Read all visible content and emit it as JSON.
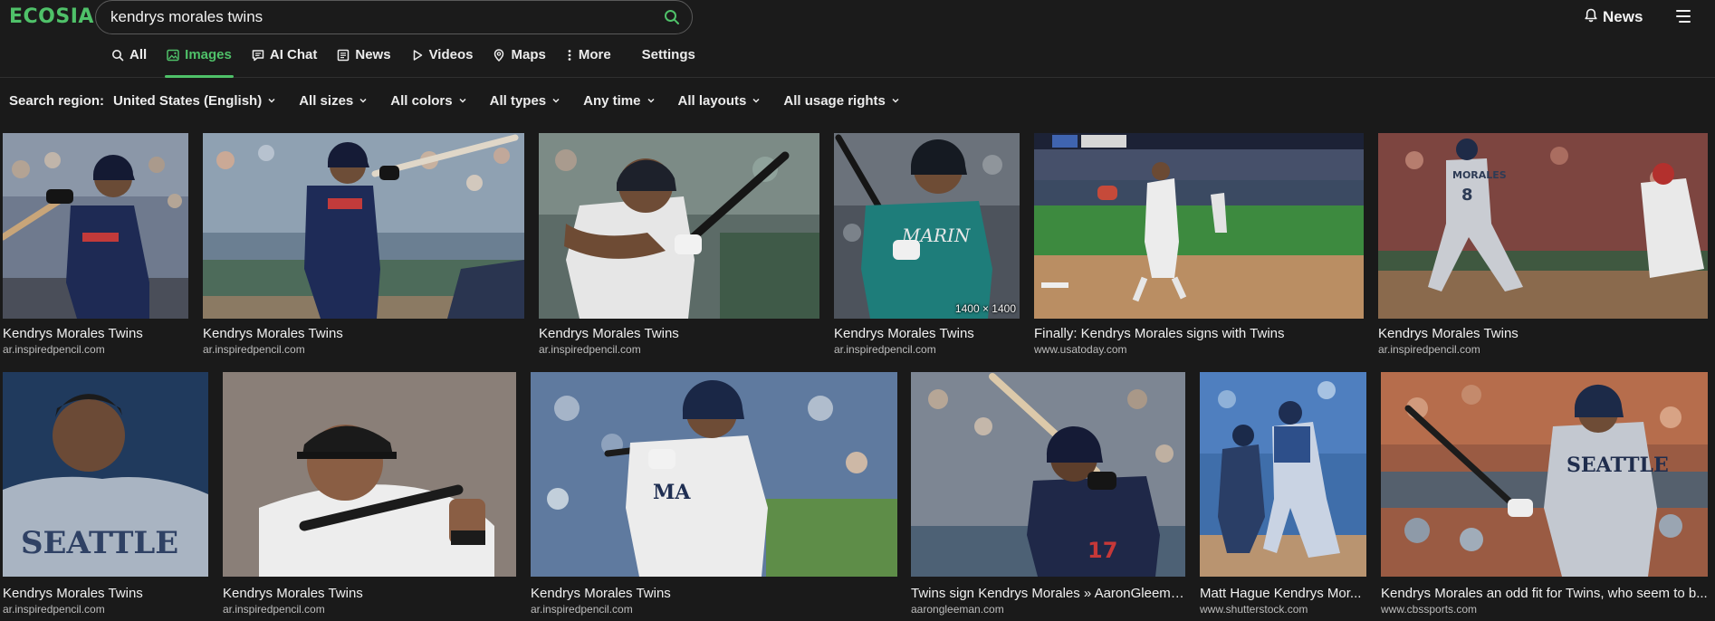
{
  "brand": {
    "logo": "ECOSIA",
    "accent": "#4fc169"
  },
  "search": {
    "query": "kendrys morales twins",
    "icon": "search-icon"
  },
  "header": {
    "news_label": "News",
    "news_icon": "bell-icon",
    "menu_icon": "hamburger-menu-icon"
  },
  "tabs": [
    {
      "label": "All",
      "icon": "search-icon",
      "active": false
    },
    {
      "label": "Images",
      "icon": "image-icon",
      "active": true
    },
    {
      "label": "AI Chat",
      "icon": "chat-icon",
      "active": false
    },
    {
      "label": "News",
      "icon": "newspaper-icon",
      "active": false
    },
    {
      "label": "Videos",
      "icon": "play-icon",
      "active": false
    },
    {
      "label": "Maps",
      "icon": "map-pin-icon",
      "active": false
    },
    {
      "label": "More",
      "icon": "more-vertical-icon",
      "active": false
    }
  ],
  "settings_label": "Settings",
  "filters": {
    "region_prefix": "Search region:",
    "region_value": "United States (English)",
    "sizes": "All sizes",
    "colors": "All colors",
    "types": "All types",
    "time": "Any time",
    "layouts": "All layouts",
    "usage": "All usage rights"
  },
  "results": [
    {
      "title": "Kendrys Morales Twins",
      "source": "ar.inspiredpencil.com",
      "dims": ""
    },
    {
      "title": "Kendrys Morales Twins",
      "source": "ar.inspiredpencil.com",
      "dims": ""
    },
    {
      "title": "Kendrys Morales Twins",
      "source": "ar.inspiredpencil.com",
      "dims": ""
    },
    {
      "title": "Kendrys Morales Twins",
      "source": "ar.inspiredpencil.com",
      "dims": "1400 × 1400"
    },
    {
      "title": "Finally: Kendrys Morales signs with Twins",
      "source": "www.usatoday.com",
      "dims": ""
    },
    {
      "title": "Kendrys Morales Twins",
      "source": "ar.inspiredpencil.com",
      "dims": ""
    },
    {
      "title": "Kendrys Morales Twins",
      "source": "ar.inspiredpencil.com",
      "dims": ""
    },
    {
      "title": "Kendrys Morales Twins",
      "source": "ar.inspiredpencil.com",
      "dims": ""
    },
    {
      "title": "Kendrys Morales Twins",
      "source": "ar.inspiredpencil.com",
      "dims": ""
    },
    {
      "title": "Twins sign Kendrys Morales » AaronGleema...",
      "source": "aarongleeman.com",
      "dims": ""
    },
    {
      "title": "Matt Hague Kendrys Mor...",
      "source": "www.shutterstock.com",
      "dims": ""
    },
    {
      "title": "Kendrys Morales an odd fit for Twins, who seem to b...",
      "source": "www.cbssports.com",
      "dims": ""
    }
  ]
}
